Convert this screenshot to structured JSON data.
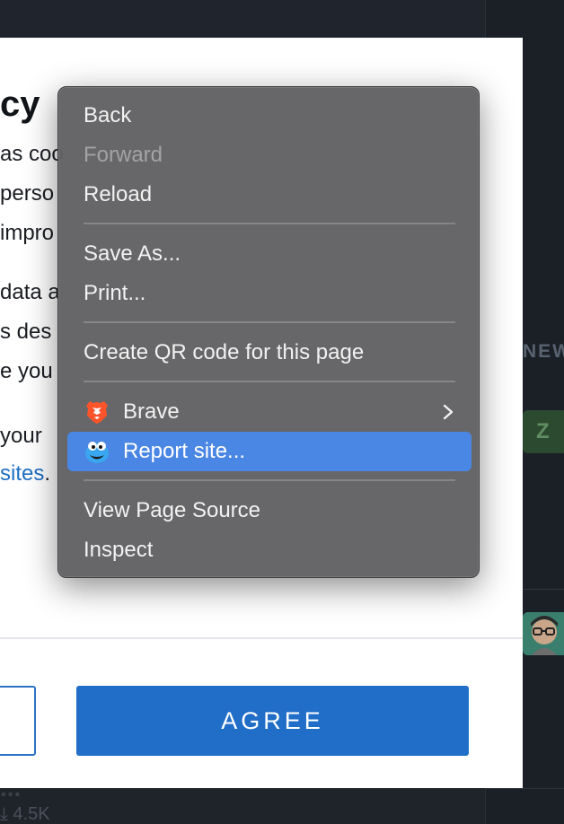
{
  "background": {
    "sidebar_section_label": "NEW",
    "badge_letter": "Z",
    "bottom_title": "...",
    "bottom_meta": "4.5K"
  },
  "modal": {
    "title": "cy",
    "lines": [
      "as coo",
      "perso",
      "impro",
      "data a",
      "s des",
      "e you",
      "your"
    ],
    "link_text": "sites",
    "link_suffix": ".",
    "agree_button": "AGREE"
  },
  "context_menu": {
    "items": {
      "back": "Back",
      "forward": "Forward",
      "reload": "Reload",
      "save_as": "Save As...",
      "print": "Print...",
      "create_qr": "Create QR code for this page",
      "brave": "Brave",
      "report_site": "Report site...",
      "view_source": "View Page Source",
      "inspect": "Inspect"
    },
    "disabled_items": [
      "forward"
    ],
    "highlighted_item": "report_site"
  },
  "colors": {
    "menu_highlight": "#4a86e3",
    "agree_button": "#216ec8",
    "link": "#1f6fc3",
    "brave_orange": "#fb542b",
    "report_icon_blue": "#3aa6f0"
  }
}
